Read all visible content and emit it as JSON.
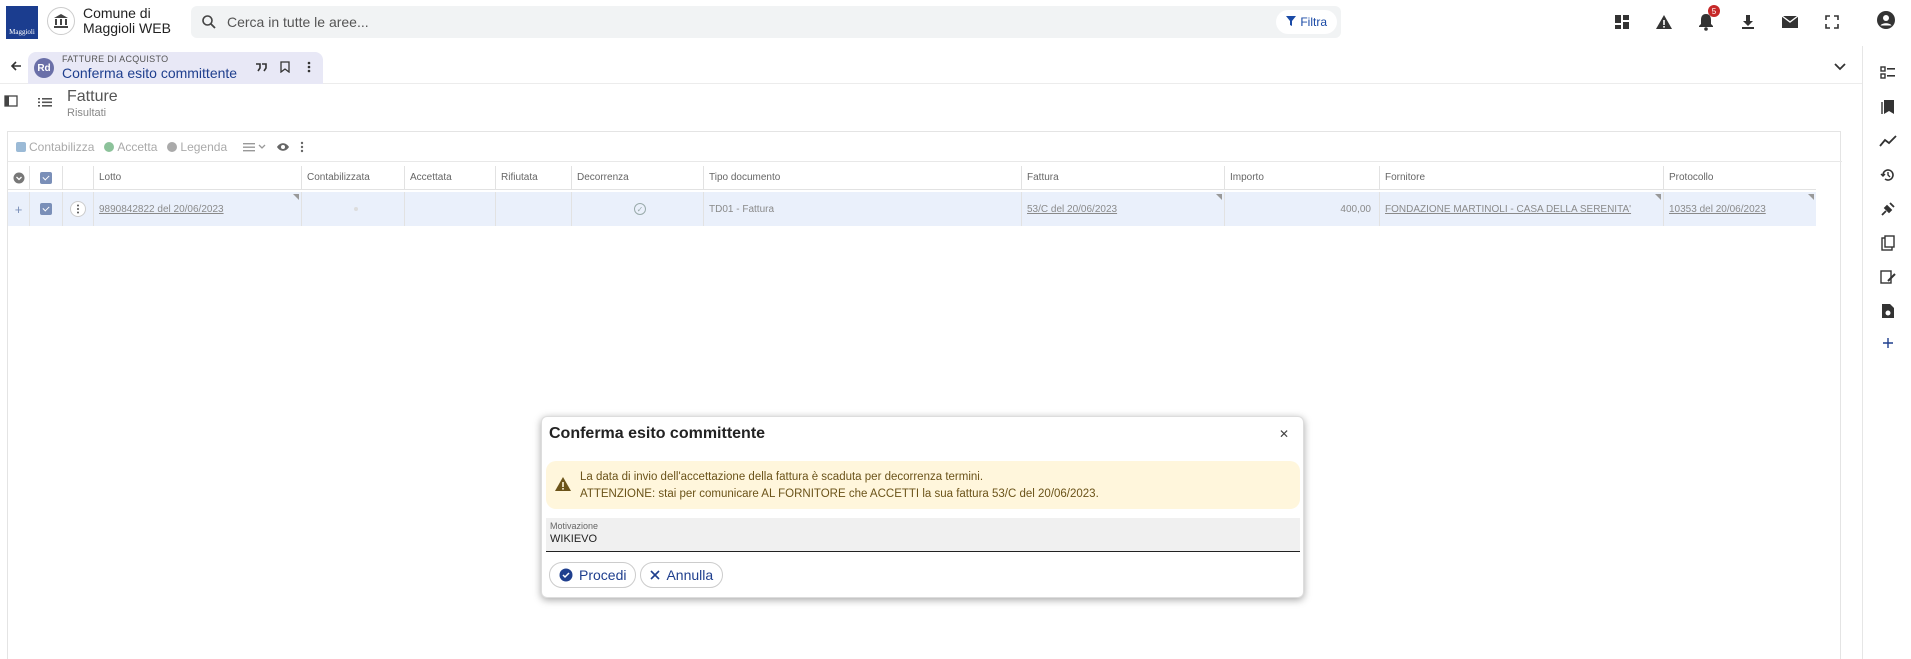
{
  "app": {
    "logo_text": "Maggioli",
    "name_line1": "Comune di",
    "name_line2": "Maggioli WEB"
  },
  "search": {
    "placeholder": "Cerca in tutte le aree...",
    "filter_label": "Filtra"
  },
  "topbar": {
    "notification_count": "5",
    "icons": [
      "dashboard-icon",
      "warning-icon",
      "bell-icon",
      "download-icon",
      "mail-icon",
      "fullscreen-icon",
      "account-icon"
    ]
  },
  "tab": {
    "badge": "Rd",
    "subtitle": "FATTURE DI ACQUISTO",
    "title": "Conferma esito committente"
  },
  "page": {
    "title": "Fatture",
    "subtitle": "Risultati"
  },
  "toolbar": {
    "contabilizza": "Contabilizza",
    "accetta": "Accetta",
    "legenda": "Legenda"
  },
  "table": {
    "columns": [
      "Lotto",
      "Contabilizzata",
      "Accettata",
      "Rifiutata",
      "Decorrenza",
      "Tipo documento",
      "Fattura",
      "Importo",
      "Fornitore",
      "Protocollo"
    ],
    "rows": [
      {
        "lotto": "9890842822 del 20/06/2023",
        "contabilizzata": "",
        "accettata": "",
        "rifiutata": "",
        "decorrenza": "✓",
        "tipo_documento": "TD01 - Fattura",
        "fattura": "53/C del 20/06/2023",
        "importo": "400,00",
        "fornitore": "FONDAZIONE MARTINOLI - CASA DELLA SERENITA'",
        "protocollo": "10353 del 20/06/2023"
      }
    ]
  },
  "dialog": {
    "title": "Conferma esito committente",
    "warning_line1": "La data di invio dell'accettazione della fattura è scaduta per decorrenza termini.",
    "warning_line2": "ATTENZIONE: stai per comunicare AL FORNITORE che ACCETTI la sua fattura 53/C del 20/06/2023.",
    "field_label": "Motivazione",
    "field_value": "WIKIEVO",
    "proceed_label": "Procedi",
    "cancel_label": "Annulla"
  },
  "colors": {
    "primary": "#1f3f8e",
    "warning_bg": "#fff6dc",
    "row_selected": "#eaf0fb"
  }
}
